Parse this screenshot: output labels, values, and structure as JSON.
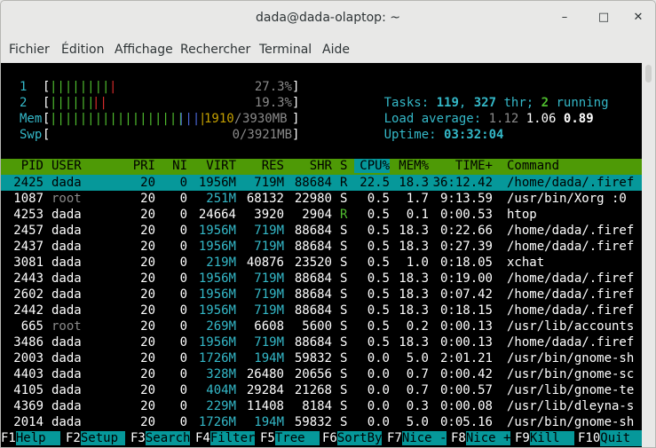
{
  "window": {
    "title": "dada@dada-olaptop: ~",
    "btn_min": "–",
    "btn_max": "□",
    "btn_close": "✕"
  },
  "menu": [
    "Fichier",
    "Édition",
    "Affichage",
    "Rechercher",
    "Terminal",
    "Aide"
  ],
  "meters": {
    "cpu1": {
      "label": "1",
      "value": "27.3%"
    },
    "cpu2": {
      "label": "2",
      "value": "19.3%"
    },
    "mem": {
      "label": "Mem",
      "used": "1910",
      "total": "3930MB"
    },
    "swp": {
      "label": "Swp",
      "value": "0/3921MB"
    }
  },
  "stats": {
    "tasks_label": "Tasks: ",
    "tasks": "119",
    "thr": "327",
    "thr_label": " thr; ",
    "running": "2",
    "running_label": " running",
    "load_label": "Load average: ",
    "load1": "1.12",
    "load5": "1.06",
    "load15": "0.89",
    "uptime_label": "Uptime: ",
    "uptime": "03:32:04"
  },
  "columns": [
    "PID",
    "USER",
    "PRI",
    "NI",
    "VIRT",
    "RES",
    "SHR",
    "S",
    "CPU%",
    "MEM%",
    "TIME+",
    "Command"
  ],
  "processes": [
    {
      "pid": "2425",
      "user": "dada",
      "pri": "20",
      "ni": "0",
      "virt": "1956M",
      "res": "719M",
      "shr": "88684",
      "s": "R",
      "cpu": "22.5",
      "mem": "18.3",
      "time": "36:12.42",
      "cmd": "/home/dada/.firef"
    },
    {
      "pid": "1087",
      "user": "root",
      "pri": "20",
      "ni": "0",
      "virt": "251M",
      "res": "68132",
      "shr": "22980",
      "s": "S",
      "cpu": "0.5",
      "mem": "1.7",
      "time": "9:13.59",
      "cmd": "/usr/bin/Xorg :0"
    },
    {
      "pid": "4253",
      "user": "dada",
      "pri": "20",
      "ni": "0",
      "virt": "24664",
      "res": "3920",
      "shr": "2904",
      "s": "R",
      "cpu": "0.5",
      "mem": "0.1",
      "time": "0:00.53",
      "cmd": "htop"
    },
    {
      "pid": "2457",
      "user": "dada",
      "pri": "20",
      "ni": "0",
      "virt": "1956M",
      "res": "719M",
      "shr": "88684",
      "s": "S",
      "cpu": "0.5",
      "mem": "18.3",
      "time": "0:22.66",
      "cmd": "/home/dada/.firef"
    },
    {
      "pid": "2437",
      "user": "dada",
      "pri": "20",
      "ni": "0",
      "virt": "1956M",
      "res": "719M",
      "shr": "88684",
      "s": "S",
      "cpu": "0.5",
      "mem": "18.3",
      "time": "0:27.39",
      "cmd": "/home/dada/.firef"
    },
    {
      "pid": "3081",
      "user": "dada",
      "pri": "20",
      "ni": "0",
      "virt": "219M",
      "res": "40876",
      "shr": "23520",
      "s": "S",
      "cpu": "0.5",
      "mem": "1.0",
      "time": "0:18.05",
      "cmd": "xchat"
    },
    {
      "pid": "2443",
      "user": "dada",
      "pri": "20",
      "ni": "0",
      "virt": "1956M",
      "res": "719M",
      "shr": "88684",
      "s": "S",
      "cpu": "0.5",
      "mem": "18.3",
      "time": "0:19.00",
      "cmd": "/home/dada/.firef"
    },
    {
      "pid": "2602",
      "user": "dada",
      "pri": "20",
      "ni": "0",
      "virt": "1956M",
      "res": "719M",
      "shr": "88684",
      "s": "S",
      "cpu": "0.5",
      "mem": "18.3",
      "time": "0:07.42",
      "cmd": "/home/dada/.firef"
    },
    {
      "pid": "2442",
      "user": "dada",
      "pri": "20",
      "ni": "0",
      "virt": "1956M",
      "res": "719M",
      "shr": "88684",
      "s": "S",
      "cpu": "0.5",
      "mem": "18.3",
      "time": "0:18.15",
      "cmd": "/home/dada/.firef"
    },
    {
      "pid": "665",
      "user": "root",
      "pri": "20",
      "ni": "0",
      "virt": "269M",
      "res": "6608",
      "shr": "5600",
      "s": "S",
      "cpu": "0.5",
      "mem": "0.2",
      "time": "0:00.13",
      "cmd": "/usr/lib/accounts"
    },
    {
      "pid": "3486",
      "user": "dada",
      "pri": "20",
      "ni": "0",
      "virt": "1956M",
      "res": "719M",
      "shr": "88684",
      "s": "S",
      "cpu": "0.5",
      "mem": "18.3",
      "time": "0:00.13",
      "cmd": "/home/dada/.firef"
    },
    {
      "pid": "2003",
      "user": "dada",
      "pri": "20",
      "ni": "0",
      "virt": "1726M",
      "res": "194M",
      "shr": "59832",
      "s": "S",
      "cpu": "0.0",
      "mem": "5.0",
      "time": "2:01.21",
      "cmd": "/usr/bin/gnome-sh"
    },
    {
      "pid": "4403",
      "user": "dada",
      "pri": "20",
      "ni": "0",
      "virt": "328M",
      "res": "26480",
      "shr": "20656",
      "s": "S",
      "cpu": "0.0",
      "mem": "0.7",
      "time": "0:00.42",
      "cmd": "/usr/bin/gnome-sc"
    },
    {
      "pid": "4105",
      "user": "dada",
      "pri": "20",
      "ni": "0",
      "virt": "404M",
      "res": "29284",
      "shr": "21268",
      "s": "S",
      "cpu": "0.0",
      "mem": "0.7",
      "time": "0:00.57",
      "cmd": "/usr/lib/gnome-te"
    },
    {
      "pid": "4369",
      "user": "dada",
      "pri": "20",
      "ni": "0",
      "virt": "229M",
      "res": "11408",
      "shr": "8184",
      "s": "S",
      "cpu": "0.0",
      "mem": "0.3",
      "time": "0:00.08",
      "cmd": "/usr/lib/dleyna-s"
    },
    {
      "pid": "2014",
      "user": "dada",
      "pri": "20",
      "ni": "0",
      "virt": "1726M",
      "res": "194M",
      "shr": "59832",
      "s": "S",
      "cpu": "0.0",
      "mem": "5.0",
      "time": "0:05.16",
      "cmd": "/usr/bin/gnome-sh"
    }
  ],
  "footer": [
    {
      "key": "F1",
      "label": "Help  "
    },
    {
      "key": "F2",
      "label": "Setup "
    },
    {
      "key": "F3",
      "label": "Search"
    },
    {
      "key": "F4",
      "label": "Filter"
    },
    {
      "key": "F5",
      "label": "Tree  "
    },
    {
      "key": "F6",
      "label": "SortBy"
    },
    {
      "key": "F7",
      "label": "Nice -"
    },
    {
      "key": "F8",
      "label": "Nice +"
    },
    {
      "key": "F9",
      "label": "Kill  "
    },
    {
      "key": "F10",
      "label": "Quit"
    }
  ]
}
